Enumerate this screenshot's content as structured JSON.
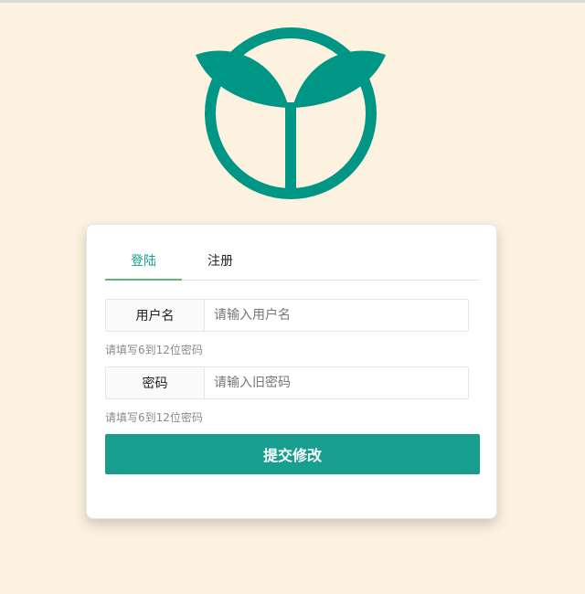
{
  "tabs": [
    {
      "label": "登陆",
      "active": true
    },
    {
      "label": "注册",
      "active": false
    }
  ],
  "form": {
    "username": {
      "label": "用户名",
      "placeholder": "请输入用户名",
      "value": "",
      "hint": "请填写6到12位密码"
    },
    "password": {
      "label": "密码",
      "placeholder": "请输入旧密码",
      "value": "",
      "hint": "请填写6到12位密码"
    },
    "submit_label": "提交修改"
  },
  "logo": {
    "icon": "sprout-logo-icon"
  },
  "colors": {
    "background": "#fdf1df",
    "brand": "#009685",
    "button": "#179e8f",
    "tab_active": "#16a089",
    "tab_underline": "#5fb878",
    "hint": "#8a8a8a"
  }
}
